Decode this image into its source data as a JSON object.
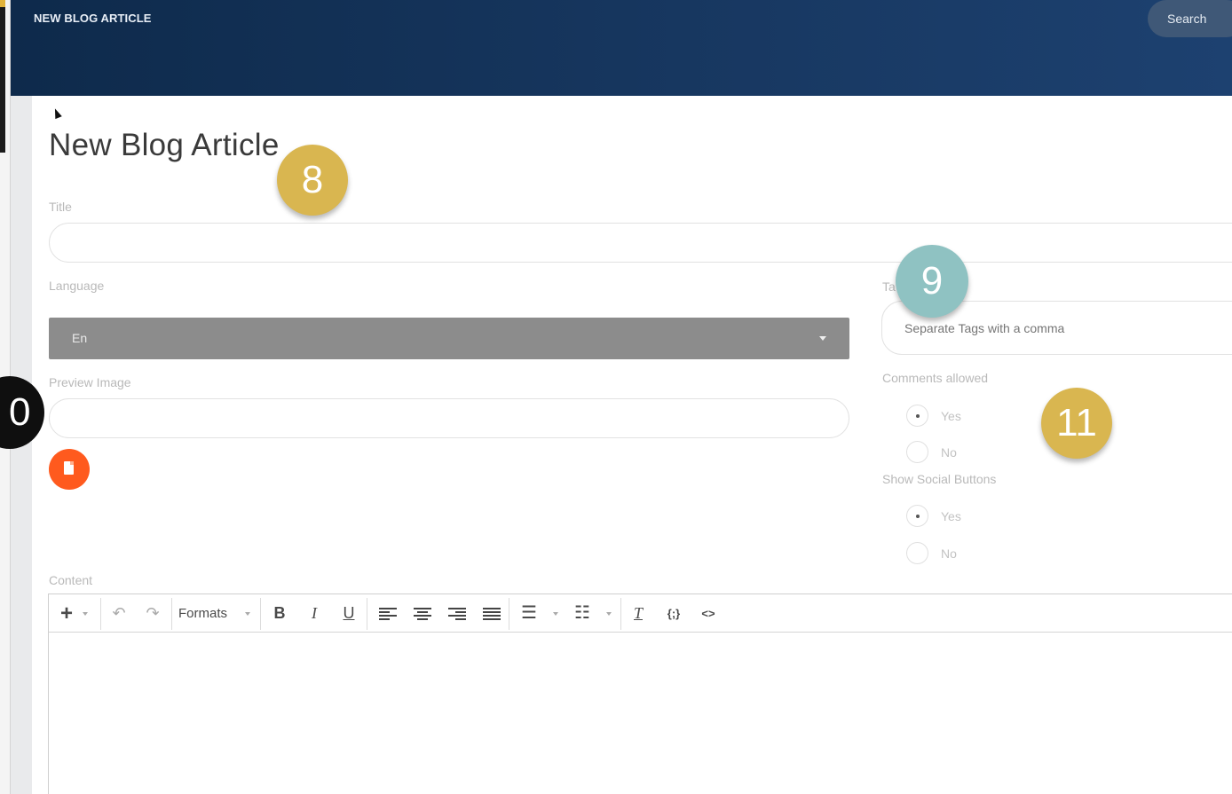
{
  "header": {
    "title": "NEW BLOG ARTICLE",
    "search_label": "Search"
  },
  "page": {
    "title": "New Blog Article"
  },
  "form": {
    "title_label": "Title",
    "title_value": "",
    "language_label": "Language",
    "language_value": "En",
    "preview_label": "Preview Image",
    "preview_value": "",
    "tags_label_partial": "Ta",
    "tags_placeholder": "Separate Tags with a comma",
    "comments_label": "Comments allowed",
    "comments_yes": "Yes",
    "comments_no": "No",
    "comments_selected": "Yes",
    "social_label": "Show Social Buttons",
    "social_yes": "Yes",
    "social_no": "No",
    "social_selected": "Yes",
    "content_label": "Content"
  },
  "toolbar": {
    "insert_icon": "plus-icon",
    "formats_label": "Formats",
    "bold_label": "B",
    "italic_label": "I",
    "underline_label": "U",
    "clear_format_label": "T",
    "code_sample_label": "{;}",
    "source_code_label": "<>"
  },
  "badges": {
    "b8": "8",
    "b9": "9",
    "b11": "11",
    "b0": "0"
  },
  "colors": {
    "header": "#173760",
    "file_button": "#ff5a1e",
    "badge_gold": "#d9b650",
    "badge_teal": "#8fc2c2"
  }
}
